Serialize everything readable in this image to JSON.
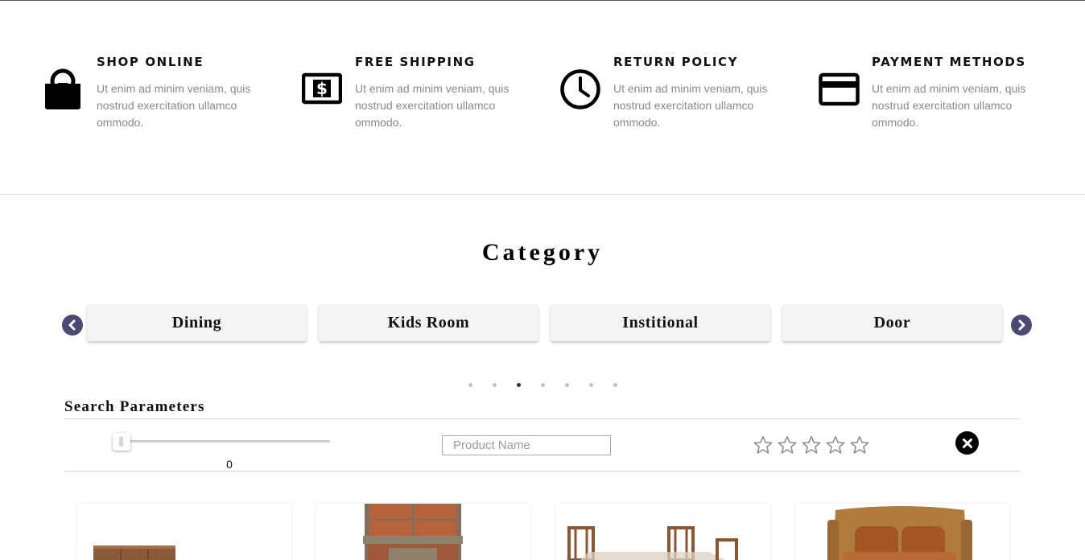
{
  "features": [
    {
      "title": "SHOP ONLINE",
      "text": "Ut enim ad minim veniam, quis nostrud exercitation ullamco ommodo.",
      "icon": "shopping-bag-icon"
    },
    {
      "title": "FREE SHIPPING",
      "text": "Ut enim ad minim veniam, quis nostrud exercitation ullamco ommodo.",
      "icon": "dollar-bill-icon"
    },
    {
      "title": "RETURN POLICY",
      "text": "Ut enim ad minim veniam, quis nostrud exercitation ullamco ommodo.",
      "icon": "clock-icon"
    },
    {
      "title": "PAYMENT METHODS",
      "text": "Ut enim ad minim veniam, quis nostrud exercitation ullamco ommodo.",
      "icon": "credit-card-icon"
    }
  ],
  "category": {
    "title": "Category",
    "items": [
      "Dining",
      "Kids Room",
      "Institional",
      "Door"
    ],
    "prev_icon": "chevron-left-icon",
    "next_icon": "chevron-right-icon",
    "dots_total": 7,
    "dots_active_index": 2
  },
  "search": {
    "title": "Search Parameters",
    "price_value": "0",
    "product_name_placeholder": "Product Name",
    "product_name_value": "",
    "rating_stars": 5,
    "rating_value": 0,
    "clear_icon": "close-circle-icon"
  },
  "products": [
    {
      "icon": "cabinet-image"
    },
    {
      "icon": "hutch-image"
    },
    {
      "icon": "dining-set-image"
    },
    {
      "icon": "loveseat-image"
    }
  ],
  "colors": {
    "accent_arrow": "#4a4a72",
    "muted_text": "#8a8a8a",
    "dot_active": "#333333",
    "dot_inactive": "#c2c2c2"
  }
}
